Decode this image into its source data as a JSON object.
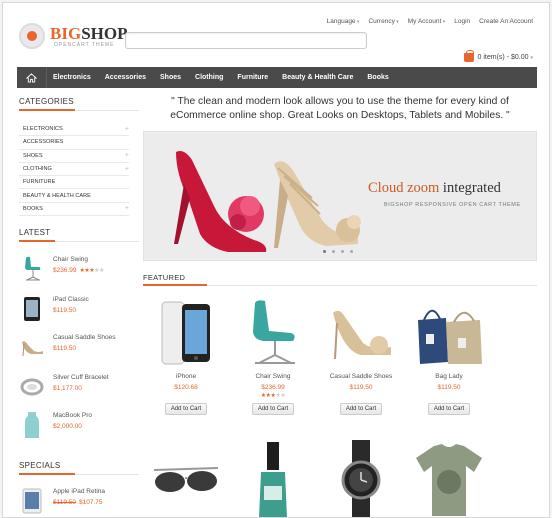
{
  "header": {
    "logo_main_a": "BIG",
    "logo_main_b": "SHOP",
    "logo_sub": "OPENCART THEME",
    "top_links": [
      "Language",
      "Currency",
      "My Account",
      "Login",
      "Create An Account"
    ],
    "search_placeholder": "",
    "cart_label": "0 item(s) - $0.00"
  },
  "nav": {
    "items": [
      "Electronics",
      "Accessories",
      "Shoes",
      "Clothing",
      "Furniture",
      "Beauty & Health Care",
      "Books"
    ]
  },
  "sidebar": {
    "categories_title": "CATEGORIES",
    "categories": [
      {
        "label": "ELECTRONICS",
        "expandable": true
      },
      {
        "label": "ACCESSORIES",
        "expandable": false
      },
      {
        "label": "SHOES",
        "expandable": true
      },
      {
        "label": "CLOTHING",
        "expandable": true
      },
      {
        "label": "FURNITURE",
        "expandable": false
      },
      {
        "label": "BEAUTY & HEALTH CARE",
        "expandable": false
      },
      {
        "label": "BOOKS",
        "expandable": true
      }
    ],
    "latest_title": "LATEST",
    "latest": [
      {
        "name": "Chair Swing",
        "price": "$236.99",
        "rating": 3
      },
      {
        "name": "iPad Classic",
        "price": "$119.50"
      },
      {
        "name": "Casual Saddle Shoes",
        "price": "$119.50"
      },
      {
        "name": "Silver Cuff Bracelet",
        "price": "$1,177.00"
      },
      {
        "name": "MacBook Pro",
        "price": "$2,000.00"
      }
    ],
    "specials_title": "SPECIALS",
    "specials": [
      {
        "name": "Apple iPad Retina",
        "old_price": "$119.50",
        "price": "$107.75"
      }
    ]
  },
  "main": {
    "quote": "\" The clean and modern look allows you to  use the theme for every kind of eCommerce online shop. Great Looks on Desktops, Tablets and Mobiles. \"",
    "slider": {
      "headline_a": "Cloud zoom ",
      "headline_b": "integrated",
      "subline": "BIGSHOP RESPONSIVE OPEN CART THEME",
      "slide_count": 4,
      "active_slide": 1
    },
    "featured_title": "FEATURED",
    "add_to_cart_label": "Add to Cart",
    "featured": [
      {
        "name": "iPhone",
        "price": "$120.68"
      },
      {
        "name": "Chair Swing",
        "price": "$236.99",
        "rating": 3
      },
      {
        "name": "Casual Saddle Shoes",
        "price": "$119.50"
      },
      {
        "name": "Bag Lady",
        "price": "$119.50"
      }
    ]
  },
  "colors": {
    "accent": "#e8652b",
    "nav_bg": "#4a4a4a"
  }
}
